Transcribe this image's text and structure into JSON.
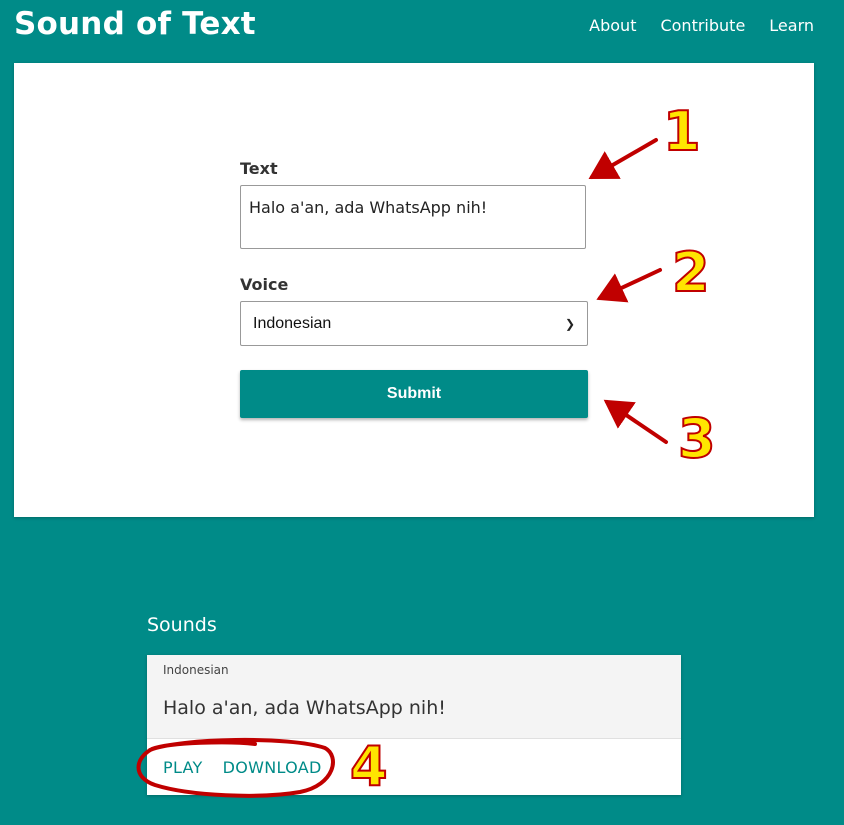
{
  "header": {
    "title": "Sound of Text",
    "nav": [
      "About",
      "Contribute",
      "Learn"
    ]
  },
  "form": {
    "text_label": "Text",
    "text_value": "Halo a'an, ada WhatsApp nih!",
    "voice_label": "Voice",
    "voice_selected": "Indonesian",
    "submit_label": "Submit"
  },
  "sounds": {
    "heading": "Sounds",
    "items": [
      {
        "voice": "Indonesian",
        "text": "Halo a'an, ada WhatsApp nih!",
        "actions": [
          "PLAY",
          "DOWNLOAD"
        ]
      }
    ]
  },
  "annotations": {
    "labels": [
      "1",
      "2",
      "3",
      "4"
    ],
    "arrow_color": "#c00000",
    "number_color": "#ffe500"
  },
  "colors": {
    "brand_teal": "#008b88",
    "card_white": "#ffffff"
  }
}
